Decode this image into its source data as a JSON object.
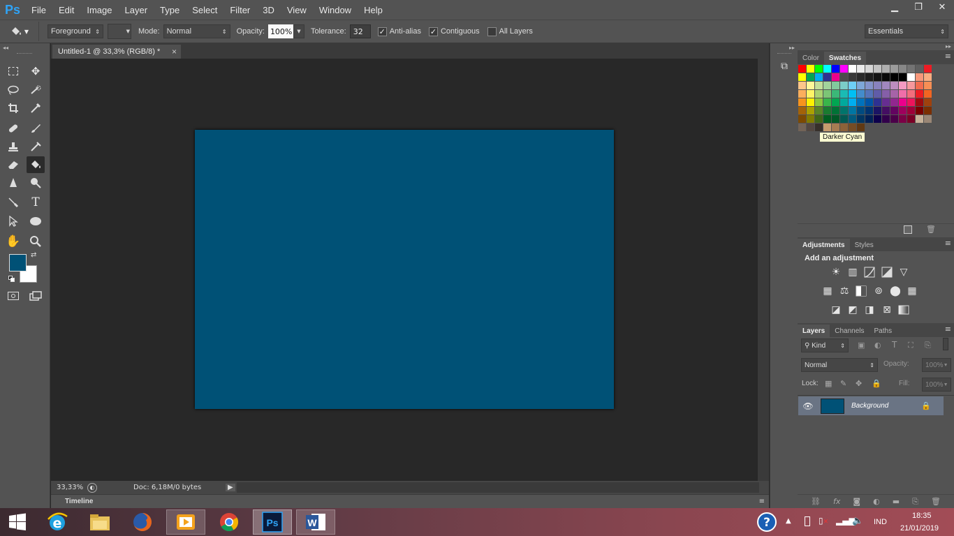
{
  "app": {
    "logo": "Ps",
    "min": "▁",
    "restore": "❐",
    "close": "✕"
  },
  "menu": [
    "File",
    "Edit",
    "Image",
    "Layer",
    "Type",
    "Select",
    "Filter",
    "3D",
    "View",
    "Window",
    "Help"
  ],
  "options": {
    "fill_source": "Foreground",
    "mode_label": "Mode:",
    "mode_value": "Normal",
    "opacity_label": "Opacity:",
    "opacity_value": "100%",
    "tolerance_label": "Tolerance:",
    "tolerance_value": "32",
    "antialias": "Anti-alias",
    "contiguous": "Contiguous",
    "all_layers": "All Layers",
    "workspace": "Essentials"
  },
  "document": {
    "tab_title": "Untitled-1 @ 33,3% (RGB/8) *",
    "close": "×",
    "zoom": "33,33%",
    "doc_info": "Doc: 6,18M/0 bytes",
    "canvas_color": "#005176"
  },
  "timeline": {
    "label": "Timeline"
  },
  "colors": {
    "foreground": "#005176",
    "background": "#ffffff"
  },
  "swatches_panel": {
    "tabs": [
      "Color",
      "Swatches"
    ],
    "tooltip": "Darker Cyan",
    "rows": [
      [
        "#ff0000",
        "#ffff00",
        "#00ff00",
        "#00ffff",
        "#0000ff",
        "#ff00ff",
        "#ffffff",
        "#ebebeb",
        "#d7d7d7",
        "#c3c3c3",
        "#afafaf",
        "#9b9b9b",
        "#878787",
        "#737373",
        "#5f5f5f",
        "#ed1c24"
      ],
      [
        "#ffff00",
        "#00a651",
        "#00aeef",
        "#2e3192",
        "#ec008c",
        "#4b4b4b",
        "#393939",
        "#2a2a2a",
        "#1e1e1e",
        "#141414",
        "#0a0a0a",
        "#000000",
        "#000000",
        "#ffffff",
        "#f7977a",
        "#f9ad81"
      ],
      [
        "#fdc68a",
        "#fff79a",
        "#c4df9b",
        "#a2d39c",
        "#82ca9d",
        "#7bcdc8",
        "#6ecff6",
        "#7ea7d8",
        "#8493ca",
        "#8882be",
        "#a187be",
        "#bc8dbf",
        "#f49ac2",
        "#f6989d",
        "#f26c4f",
        "#f68e55"
      ],
      [
        "#fbaf5c",
        "#fff467",
        "#acd372",
        "#7cc576",
        "#3bb878",
        "#1abbb4",
        "#00bff3",
        "#438ccb",
        "#5574b9",
        "#605ca8",
        "#855fa8",
        "#a763a8",
        "#f06ea9",
        "#f26d7d",
        "#ed1c24",
        "#f26522"
      ],
      [
        "#f7941d",
        "#fff200",
        "#8dc63f",
        "#39b54a",
        "#00a651",
        "#00a99d",
        "#00aeef",
        "#0072bc",
        "#0054a6",
        "#2e3192",
        "#662d91",
        "#92278f",
        "#ec008c",
        "#ed145b",
        "#9e0b0f",
        "#a0410d"
      ],
      [
        "#a36209",
        "#aba000",
        "#598527",
        "#1a7b30",
        "#007236",
        "#00746b",
        "#0076a3",
        "#004b80",
        "#003471",
        "#1b1464",
        "#440e62",
        "#630460",
        "#9e005d",
        "#9e0039",
        "#790000",
        "#7b2e00"
      ],
      [
        "#7d4900",
        "#827b00",
        "#406618",
        "#005e20",
        "#005826",
        "#005952",
        "#005b7f",
        "#003663",
        "#002157",
        "#0d004c",
        "#32004b",
        "#4b0049",
        "#7b0046",
        "#7a0026",
        "#c7b299",
        "#998675"
      ],
      [
        "#736357",
        "#534741",
        "#37302a",
        "#c69c6d",
        "#a67c52",
        "#8c6239",
        "#754c24",
        "#603913"
      ]
    ]
  },
  "adjustments": {
    "tabs": [
      "Adjustments",
      "Styles"
    ],
    "heading": "Add an adjustment"
  },
  "layers": {
    "tabs": [
      "Layers",
      "Channels",
      "Paths"
    ],
    "filter_kind": "Kind",
    "blend_mode": "Normal",
    "opacity_label": "Opacity:",
    "opacity_value": "100%",
    "lock_label": "Lock:",
    "fill_label": "Fill:",
    "fill_value": "100%",
    "items": [
      {
        "name": "Background",
        "color": "#005176"
      }
    ]
  },
  "taskbar": {
    "lang": "IND",
    "time": "18:35",
    "date": "21/01/2019"
  }
}
